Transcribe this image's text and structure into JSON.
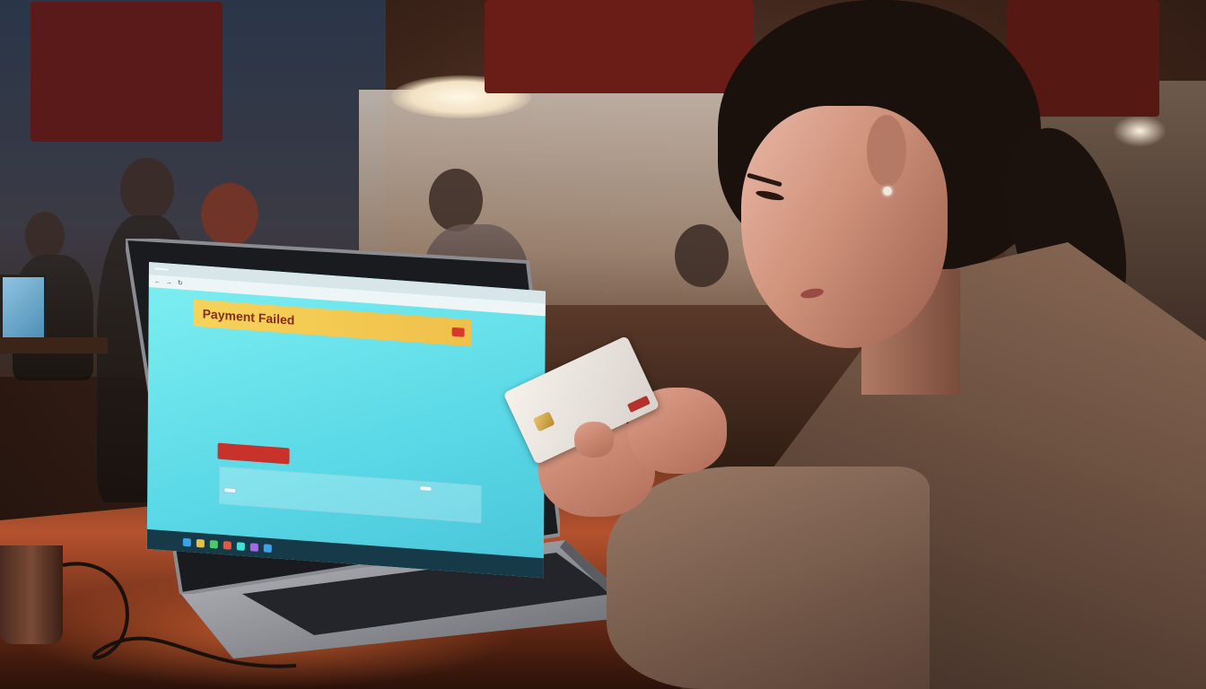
{
  "scene": {
    "description_colors": {
      "neon": "#ffd070",
      "screen": "#5ad8e6",
      "banner": "#f6d35a",
      "error_red": "#c8322a",
      "desk": "#b4522e"
    }
  },
  "signs": {
    "left": "",
    "center": "",
    "right": ""
  },
  "browser": {
    "tab_title": "",
    "url": ""
  },
  "payment_page": {
    "banner_title": "Payment Failed",
    "banner_subtitle": "",
    "section_label": "",
    "amount_left": "",
    "amount_right": "",
    "fields": [],
    "message_line1": "",
    "message_line2": "",
    "retry_button": "",
    "form_button_left": "",
    "form_button_right": "",
    "table_headers": []
  },
  "card": {
    "bank_text": "",
    "logo_text": "",
    "number_text": ""
  },
  "icons": [
    "laptop-icon",
    "credit-card-icon",
    "earring-icon"
  ]
}
